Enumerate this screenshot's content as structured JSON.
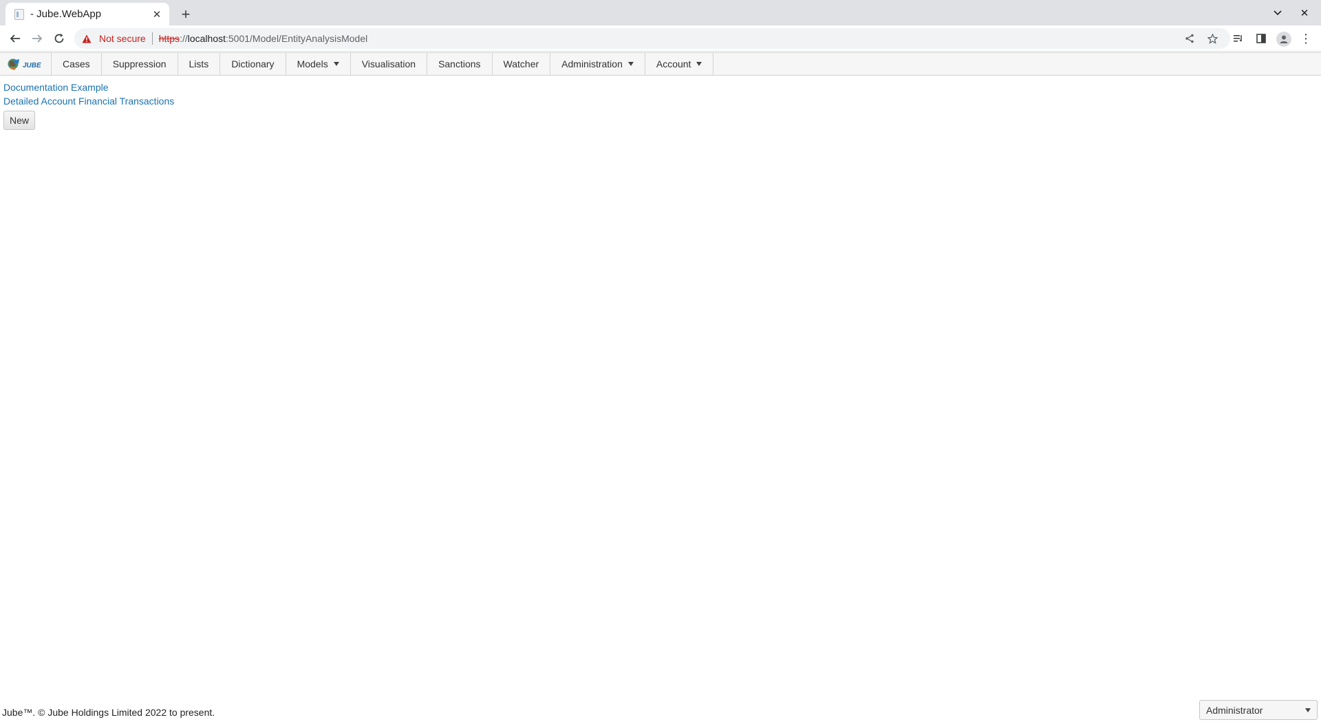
{
  "browser": {
    "tab_title": "- Jube.WebApp",
    "security_label": "Not secure",
    "url_scheme": "https",
    "url_sep": "://",
    "url_host": "localhost",
    "url_path": ":5001/Model/EntityAnalysisModel"
  },
  "nav": {
    "logo_text": "JUBE",
    "items": [
      {
        "label": "Cases",
        "dropdown": false
      },
      {
        "label": "Suppression",
        "dropdown": false
      },
      {
        "label": "Lists",
        "dropdown": false
      },
      {
        "label": "Dictionary",
        "dropdown": false
      },
      {
        "label": "Models",
        "dropdown": true
      },
      {
        "label": "Visualisation",
        "dropdown": false
      },
      {
        "label": "Sanctions",
        "dropdown": false
      },
      {
        "label": "Watcher",
        "dropdown": false
      },
      {
        "label": "Administration",
        "dropdown": true
      },
      {
        "label": "Account",
        "dropdown": true
      }
    ]
  },
  "models": {
    "links": [
      "Documentation Example",
      "Detailed Account Financial Transactions"
    ],
    "new_label": "New"
  },
  "footer": {
    "copyright": "Jube™. © Jube Holdings Limited 2022 to present.",
    "role": "Administrator"
  },
  "colors": {
    "link": "#1a72b0",
    "warning": "#c5221f"
  }
}
